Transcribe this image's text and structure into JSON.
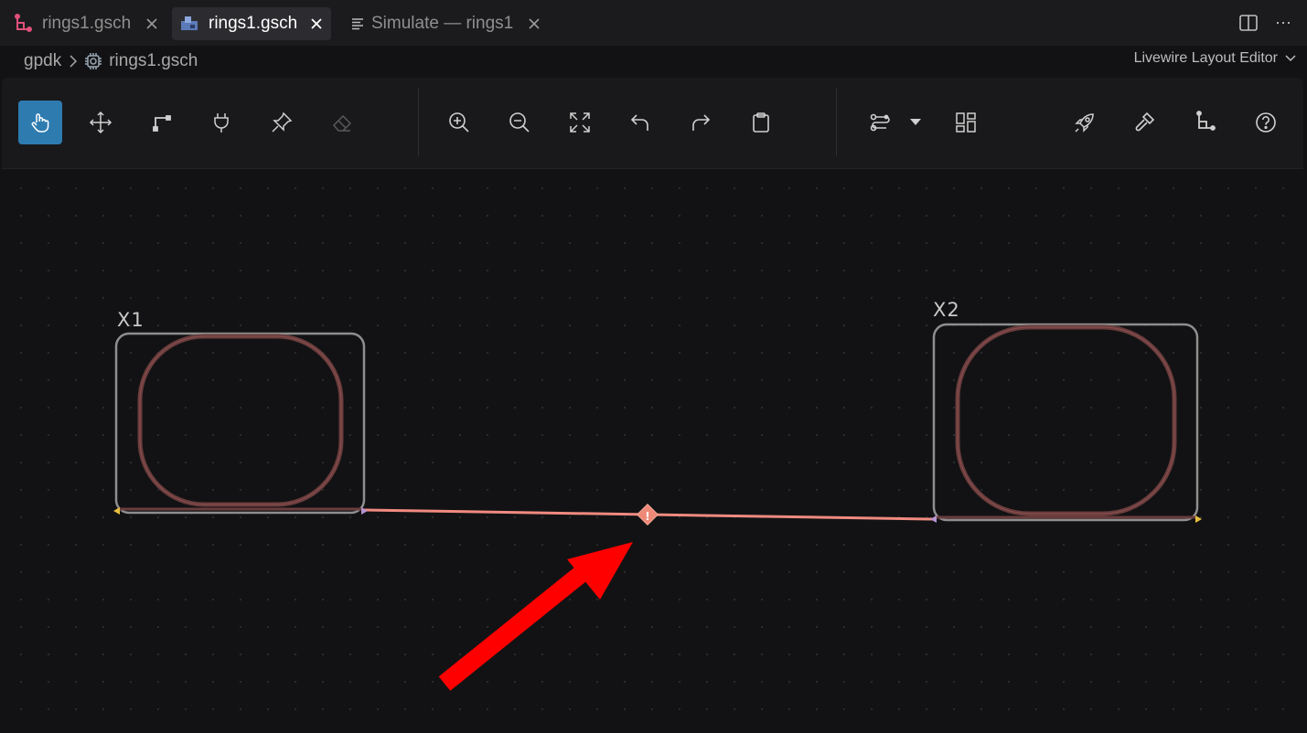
{
  "tabs": [
    {
      "label": "rings1.gsch",
      "icon": "schematic-branch-icon",
      "active": false
    },
    {
      "label": "rings1.gsch",
      "icon": "layout-file-icon",
      "active": true
    },
    {
      "label": "Simulate — rings1",
      "icon": "text-lines-icon",
      "active": false
    }
  ],
  "tabbar_actions": {
    "split": "split-editor-icon",
    "more": "⋯"
  },
  "breadcrumb": {
    "root": "gpdk",
    "file": "rings1.gsch"
  },
  "editor_select": "Livewire Layout Editor",
  "toolbar": {
    "groups": [
      [
        "select",
        "move",
        "wire",
        "port",
        "pin",
        "erase"
      ],
      [
        "zoom-in",
        "zoom-out",
        "fit",
        "undo",
        "redo",
        "clipboard"
      ],
      [
        "route",
        "route-options",
        "layout-view"
      ],
      [
        "run",
        "build",
        "netlist",
        "help"
      ]
    ],
    "active_tool": "select",
    "disabled_tools": [
      "erase"
    ]
  },
  "canvas": {
    "components": [
      {
        "label": "X1"
      },
      {
        "label": "X2"
      }
    ],
    "net_error_marker": "!",
    "colors": {
      "wire": "#f08a80",
      "error": "#ee8877",
      "box": "#8e8e8e",
      "ring": "#6a3c3c",
      "arrow": "#ff0000",
      "port": "#e8c040"
    }
  }
}
